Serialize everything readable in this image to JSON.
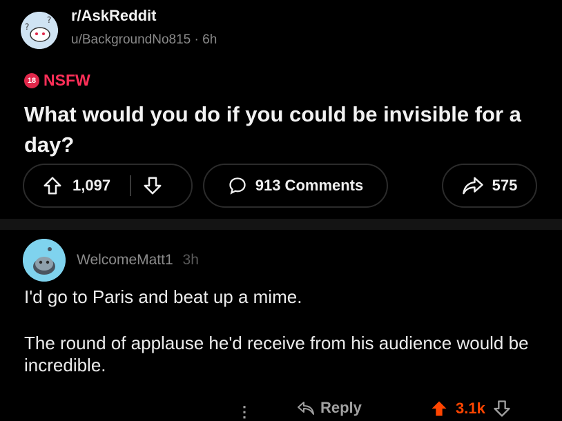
{
  "post": {
    "subreddit": "r/AskReddit",
    "author": "u/BackgroundNo815",
    "age": "6h",
    "nsfw_badge": "18",
    "nsfw_label": "NSFW",
    "title": "What would you do if you could be invisible for a day?",
    "upvotes": "1,097",
    "comments_label": "913 Comments",
    "shares": "575"
  },
  "comment": {
    "author": "WelcomeMatt1",
    "age": "3h",
    "body": [
      "I'd go to Paris and beat up a mime.",
      "The round of applause he'd receive from his audience would be incredible."
    ],
    "more": "⋮",
    "reply_label": "Reply",
    "score": "3.1k"
  },
  "colors": {
    "background": "#000000",
    "nsfw": "#ff2f58",
    "upvote_active": "#ff4500",
    "muted": "#8a8a8a"
  },
  "icons": [
    "subreddit-avatar-icon",
    "nsfw-icon",
    "upvote-icon",
    "downvote-icon",
    "comment-bubble-icon",
    "share-arrow-icon",
    "user-avatar-icon",
    "more-icon",
    "reply-icon"
  ]
}
